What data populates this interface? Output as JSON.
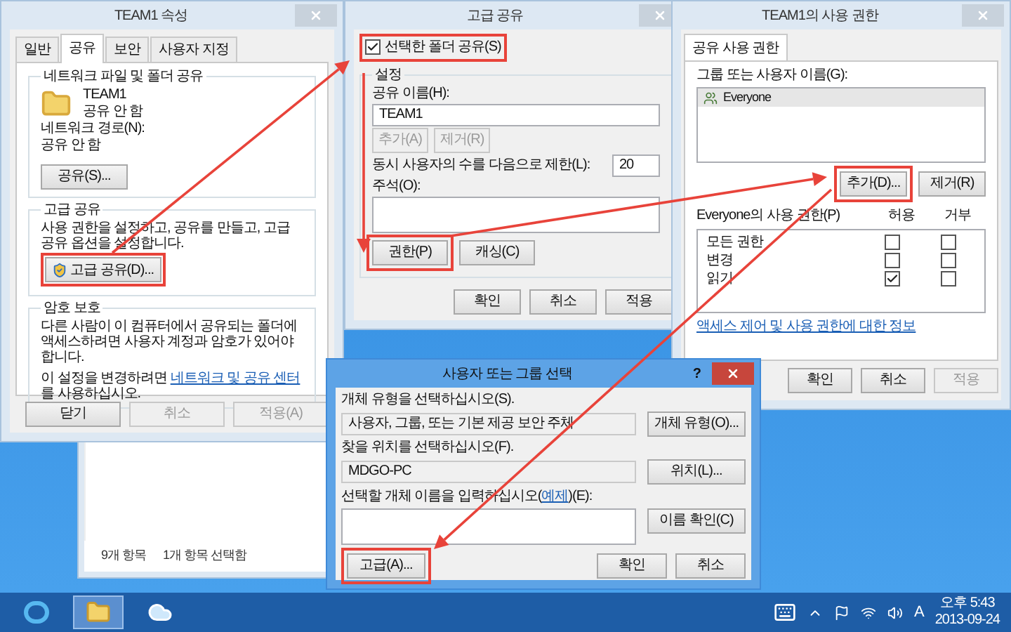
{
  "explorer_window": {
    "status_items": [
      "9개 항목",
      "1개 항목 선택함"
    ]
  },
  "properties_dialog": {
    "title": "TEAM1 속성",
    "tabs": [
      {
        "label": "일반",
        "selected": false
      },
      {
        "label": "공유",
        "selected": true
      },
      {
        "label": "보안",
        "selected": false
      },
      {
        "label": "사용자 지정",
        "selected": false
      }
    ],
    "network_sharing": {
      "heading": "네트워크 파일 및 폴더 공유",
      "folder_name": "TEAM1",
      "folder_status": "공유 안 함",
      "path_label": "네트워크 경로(N):",
      "path_value": "공유 안 함",
      "share_button": "공유(S)..."
    },
    "advanced_sharing": {
      "heading": "고급 공유",
      "description": "사용 권한을 설정하고, 공유를 만들고, 고급 공유 옵션을 설정합니다.",
      "button": {
        "label": "고급 공유(D)...",
        "highlighted": true
      }
    },
    "password": {
      "heading": "암호 보호",
      "description": "다른 사람이 이 컴퓨터에서 공유되는 폴더에 액세스하려면 사용자 계정과 암호가 있어야 합니다.",
      "change_before": "이 설정을 변경하려면 ",
      "link": "네트워크 및 공유 센터",
      "change_after": "를 사용하십시오."
    },
    "buttons": [
      {
        "label": "닫기",
        "disabled": false
      },
      {
        "label": "취소",
        "disabled": true
      },
      {
        "label": "적용(A)",
        "disabled": true
      }
    ]
  },
  "advanced_sharing_dialog": {
    "title": "고급 공유",
    "share_checkbox": {
      "label": "선택한 폴더 공유(S)",
      "checked": true,
      "highlighted": true
    },
    "settings_heading": "설정",
    "share_name_label": "공유 이름(H):",
    "share_name": "TEAM1",
    "name_buttons": [
      {
        "label": "추가(A)",
        "disabled": true
      },
      {
        "label": "제거(R)",
        "disabled": true
      }
    ],
    "limit_label": "동시 사용자의 수를 다음으로 제한(L):",
    "limit_value": "20",
    "comment_label": "주석(O):",
    "option_buttons": [
      {
        "label": "권한(P)",
        "highlighted": true
      },
      {
        "label": "캐싱(C)",
        "highlighted": false
      }
    ],
    "buttons": [
      {
        "label": "확인",
        "disabled": false
      },
      {
        "label": "취소",
        "disabled": false
      },
      {
        "label": "적용",
        "disabled": false
      }
    ]
  },
  "permissions_dialog": {
    "title": "TEAM1의 사용 권한",
    "tabs": [
      {
        "label": "공유 사용 권한",
        "selected": true
      }
    ],
    "users_label": "그룹 또는 사용자 이름(G):",
    "users": [
      {
        "name": "Everyone",
        "selected": true
      }
    ],
    "user_buttons": [
      {
        "label": "추가(D)...",
        "highlighted": true
      },
      {
        "label": "제거(R)",
        "highlighted": false
      }
    ],
    "permissions_label": "Everyone의 사용 권한(P)",
    "allow_header": "허용",
    "deny_header": "거부",
    "permissions": [
      {
        "name": "모든 권한",
        "allow": false,
        "deny": false
      },
      {
        "name": "변경",
        "allow": false,
        "deny": false
      },
      {
        "name": "읽기",
        "allow": true,
        "deny": false
      }
    ],
    "link": "액세스 제어 및 사용 권한에 대한 정보",
    "buttons": [
      {
        "label": "확인",
        "disabled": false
      },
      {
        "label": "취소",
        "disabled": false
      },
      {
        "label": "적용",
        "disabled": true
      }
    ]
  },
  "select_dialog": {
    "title": "사용자 또는 그룹 선택",
    "help": "?",
    "object_type_label": "개체 유형을 선택하십시오(S).",
    "object_type": "사용자, 그룹, 또는 기본 제공 보안 주체",
    "object_type_button": "개체 유형(O)...",
    "location_label": "찾을 위치를 선택하십시오(F).",
    "location": "MDGO-PC",
    "location_button": "위치(L)...",
    "names_label_before": "선택할 개체 이름을 입력하십시오(",
    "names_label_link": "예제",
    "names_label_after": ")(E):",
    "check_names_button": "이름 확인(C)",
    "advanced_button": {
      "label": "고급(A)...",
      "highlighted": true
    },
    "buttons": [
      {
        "label": "확인",
        "disabled": false
      },
      {
        "label": "취소",
        "disabled": false
      }
    ]
  },
  "taskbar": {
    "apps": [
      {
        "kind": "browser",
        "selected": false
      },
      {
        "kind": "explorer",
        "selected": true
      },
      {
        "kind": "cloud",
        "selected": false
      }
    ],
    "ime": "A",
    "time": "오후 5:43",
    "date": "2013-09-24"
  }
}
